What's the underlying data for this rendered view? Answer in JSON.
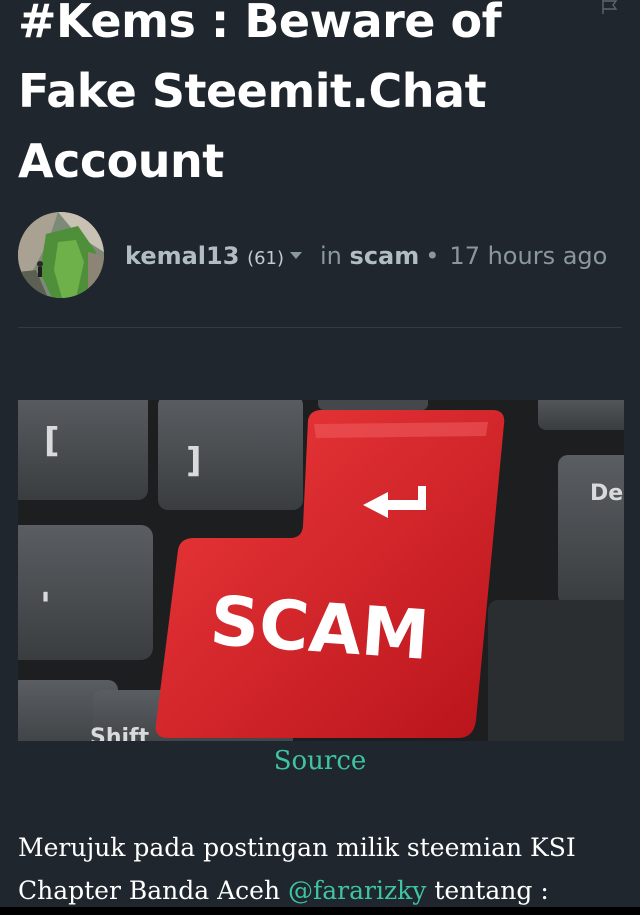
{
  "post": {
    "title": "#Kems : Beware of Fake Steemit.Chat Account",
    "author": {
      "name": "kemal13",
      "reputation": "(61)"
    },
    "in_label": "in",
    "category": "scam",
    "separator": "•",
    "timestamp": "17 hours ago",
    "hero_image": {
      "key_label": "SCAM",
      "key_letters": [
        "[",
        "]",
        "De",
        "'",
        "Shift"
      ]
    },
    "image_caption": "Source",
    "body": {
      "text_before": "Merujuk pada postingan milik steemian KSI Chapter Banda Aceh ",
      "mention": "@fararizky",
      "text_after": " tentang :"
    }
  },
  "icons": {
    "flag": "flag-icon",
    "caret": "chevron-down-icon"
  },
  "colors": {
    "background": "#1f262d",
    "link": "#3ec4a4",
    "muted_text": "#8a96a0",
    "scam_key_red": "#d8232a"
  }
}
